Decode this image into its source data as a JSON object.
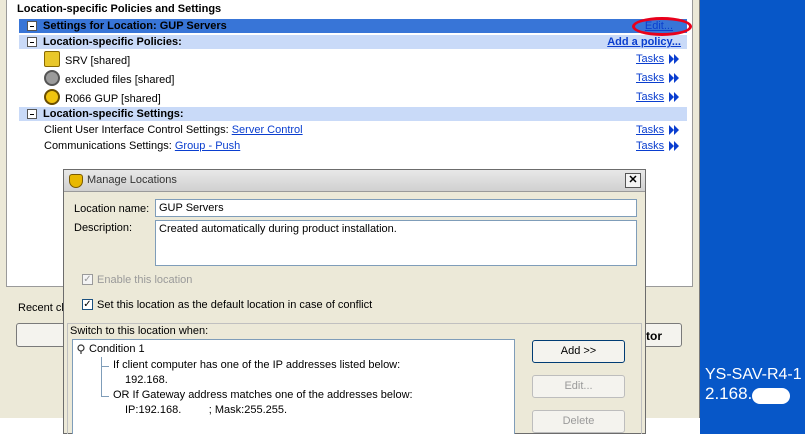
{
  "desktop": {
    "line1": "YS-SAV-R4-1",
    "line2": "2.168."
  },
  "panel": {
    "title": "Location-specific Policies and Settings",
    "settings_row": {
      "label": "Settings for Location: GUP Servers",
      "action": "Edit..."
    },
    "policies_row": {
      "label": "Location-specific Policies:",
      "action": "Add a policy..."
    },
    "policies": [
      {
        "name": "SRV [shared]",
        "icon": "policy-shield-icon",
        "tasks": "Tasks"
      },
      {
        "name": "excluded files [shared]",
        "icon": "settings-gear-icon",
        "tasks": "Tasks"
      },
      {
        "name": "R066 GUP [shared]",
        "icon": "gup-icon",
        "tasks": "Tasks"
      }
    ],
    "settings_section": {
      "label": "Location-specific Settings:"
    },
    "settings": [
      {
        "label": "Client User Interface Control Settings: ",
        "value": "Server Control",
        "tasks": "Tasks"
      },
      {
        "label": "Communications Settings: ",
        "value": "Group - Push",
        "tasks": "Tasks"
      }
    ],
    "recent_label": "Recent cl",
    "tor_label": "tor"
  },
  "dialog": {
    "title": "Manage Locations",
    "close": "✕",
    "location_name_label": "Location name:",
    "location_name_value": "GUP Servers",
    "description_label": "Description:",
    "description_value": "Created automatically during product installation.",
    "enable_label": "Enable this location",
    "default_label": "Set this location as the default location in case of conflict",
    "switch_label": "Switch to this location when:",
    "conditions": {
      "title": "Condition 1",
      "line1": "If client computer has one of the IP addresses listed below:",
      "line2": "192.168.",
      "line3": "OR If Gateway address matches one of the addresses below:",
      "line4": "IP:192.168.         ; Mask:255.255."
    },
    "buttons": {
      "add": "Add >>",
      "edit": "Edit...",
      "delete": "Delete"
    }
  },
  "colors": {
    "accent": "#3875d7",
    "link": "#0a3ecf",
    "highlight": "#e8001b"
  }
}
